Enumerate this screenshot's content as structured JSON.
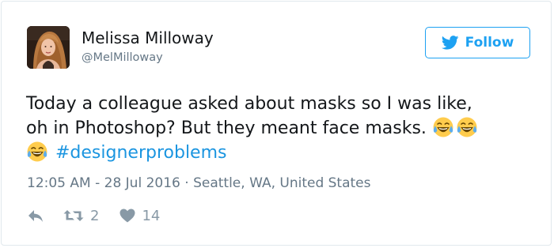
{
  "author": {
    "name": "Melissa Milloway",
    "handle": "@MelMilloway"
  },
  "follow_button": {
    "label": "Follow",
    "icon": "twitter-bird-icon",
    "color": "#1da1f2"
  },
  "tweet": {
    "line1": "Today a colleague asked about masks so I was like,",
    "line2": "oh in Photoshop? But they meant face masks.",
    "hashtag": "#designerproblems",
    "emoji": "face-with-tears-of-joy-icon"
  },
  "meta": {
    "timestamp": "12:05 AM - 28 Jul 2016",
    "separator": "·",
    "location": "Seattle, WA, United States"
  },
  "actions": {
    "reply_icon": "reply-icon",
    "retweet_icon": "retweet-icon",
    "retweet_count": "2",
    "like_icon": "heart-icon",
    "like_count": "14"
  },
  "colors": {
    "text": "#14171a",
    "muted": "#657786",
    "link": "#1b95e0",
    "action": "#8899a6"
  }
}
